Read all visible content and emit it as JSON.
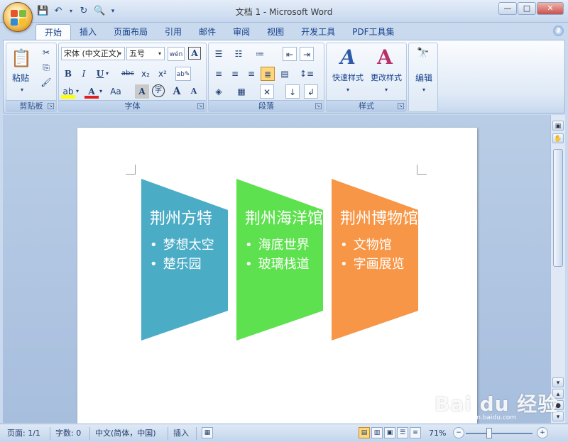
{
  "window": {
    "title": "文档 1 - Microsoft Word",
    "minimize": "—",
    "maximize": "□",
    "close": "✕"
  },
  "tabs": [
    {
      "label": "开始",
      "active": true
    },
    {
      "label": "插入"
    },
    {
      "label": "页面布局"
    },
    {
      "label": "引用"
    },
    {
      "label": "邮件"
    },
    {
      "label": "审阅"
    },
    {
      "label": "视图"
    },
    {
      "label": "开发工具"
    },
    {
      "label": "PDF工具集"
    }
  ],
  "ribbon": {
    "clipboard": {
      "label": "剪贴板",
      "paste": "粘贴"
    },
    "font": {
      "label": "字体",
      "font_name": "宋体 (中文正文)",
      "font_size": "五号",
      "bold": "B",
      "italic": "I",
      "underline": "U",
      "strike": "abc",
      "subscript": "x₂",
      "superscript": "x²",
      "grow": "A",
      "shrink": "A",
      "case": "Aa",
      "char_border": "A",
      "enclose": "字",
      "wen": "wén"
    },
    "paragraph": {
      "label": "段落"
    },
    "styles": {
      "label": "样式",
      "quick_styles": "快速样式",
      "change_styles": "更改样式"
    },
    "editing": {
      "label": "编辑"
    }
  },
  "document": {
    "cards": [
      {
        "title": "荆州方特",
        "bullets": [
          "梦想太空",
          "楚乐园"
        ],
        "color": "#4BACC6"
      },
      {
        "title": "荆州海洋馆",
        "bullets": [
          "海底世界",
          "玻璃栈道"
        ],
        "color": "#5EE14E"
      },
      {
        "title": "荆州博物馆",
        "bullets": [
          "文物馆",
          "字画展览"
        ],
        "color": "#F79646"
      }
    ]
  },
  "statusbar": {
    "page": "页面: 1/1",
    "words": "字数: 0",
    "language": "中文(简体，中国)",
    "mode": "插入",
    "zoom": "71%"
  },
  "watermark": {
    "text": "Bai du 经验",
    "sub": "jingyan.baidu.com"
  }
}
